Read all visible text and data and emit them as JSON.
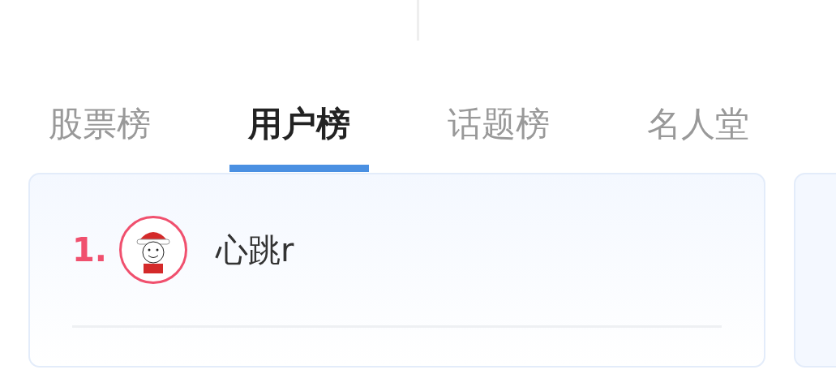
{
  "tabs": [
    {
      "label": "股票榜",
      "selected": false
    },
    {
      "label": "用户榜",
      "selected": true
    },
    {
      "label": "话题榜",
      "selected": false
    },
    {
      "label": "名人堂",
      "selected": false
    }
  ],
  "ranking": [
    {
      "rank": "1.",
      "name": "心跳r"
    }
  ]
}
